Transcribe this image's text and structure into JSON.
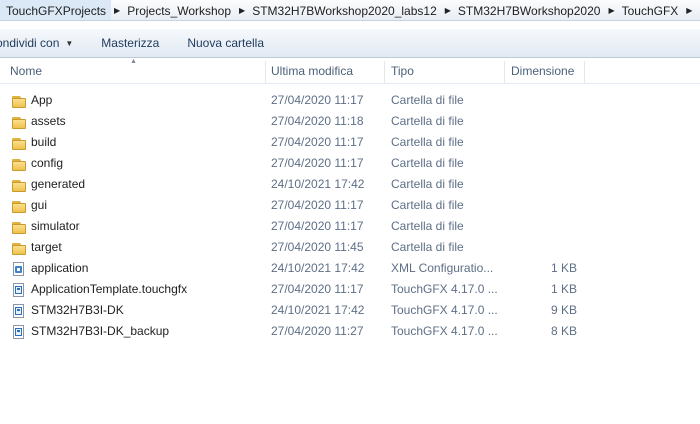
{
  "breadcrumb": [
    "TouchGFXProjects",
    "Projects_Workshop",
    "STM32H7BWorkshop2020_labs12",
    "STM32H7BWorkshop2020",
    "TouchGFX"
  ],
  "toolbar": {
    "share": "ondividi con",
    "burn": "Masterizza",
    "new_folder": "Nuova cartella"
  },
  "columns": {
    "name": "Nome",
    "modified": "Ultima modifica",
    "type": "Tipo",
    "size": "Dimensione"
  },
  "files": [
    {
      "name": "App",
      "date": "27/04/2020 11:17",
      "type": "Cartella di file",
      "size": "",
      "icon": "folder-icon"
    },
    {
      "name": "assets",
      "date": "27/04/2020 11:18",
      "type": "Cartella di file",
      "size": "",
      "icon": "folder-icon"
    },
    {
      "name": "build",
      "date": "27/04/2020 11:17",
      "type": "Cartella di file",
      "size": "",
      "icon": "folder-icon"
    },
    {
      "name": "config",
      "date": "27/04/2020 11:17",
      "type": "Cartella di file",
      "size": "",
      "icon": "folder-icon"
    },
    {
      "name": "generated",
      "date": "24/10/2021 17:42",
      "type": "Cartella di file",
      "size": "",
      "icon": "folder-icon"
    },
    {
      "name": "gui",
      "date": "27/04/2020 11:17",
      "type": "Cartella di file",
      "size": "",
      "icon": "folder-icon"
    },
    {
      "name": "simulator",
      "date": "27/04/2020 11:17",
      "type": "Cartella di file",
      "size": "",
      "icon": "folder-icon"
    },
    {
      "name": "target",
      "date": "27/04/2020 11:45",
      "type": "Cartella di file",
      "size": "",
      "icon": "folder-icon"
    },
    {
      "name": "application",
      "date": "24/10/2021 17:42",
      "type": "XML Configuratio...",
      "size": "1 KB",
      "icon": "xml-config-file-icon"
    },
    {
      "name": "ApplicationTemplate.touchgfx",
      "date": "27/04/2020 11:17",
      "type": "TouchGFX 4.17.0 ...",
      "size": "1 KB",
      "icon": "touchgfx-file-icon"
    },
    {
      "name": "STM32H7B3I-DK",
      "date": "24/10/2021 17:42",
      "type": "TouchGFX 4.17.0 ...",
      "size": "9 KB",
      "icon": "touchgfx-file-icon"
    },
    {
      "name": "STM32H7B3I-DK_backup",
      "date": "27/04/2020 11:27",
      "type": "TouchGFX 4.17.0 ...",
      "size": "8 KB",
      "icon": "touchgfx-file-icon"
    }
  ]
}
